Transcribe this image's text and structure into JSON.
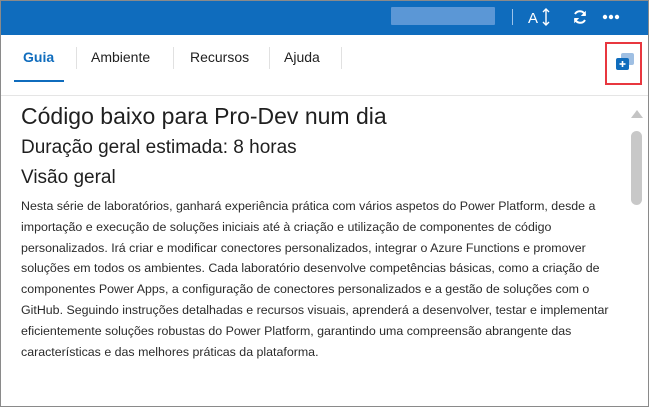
{
  "toolbar": {
    "text_size_icon": "text-size-icon",
    "refresh_icon": "refresh-icon",
    "more_icon": "more-options-icon",
    "accent": "#0f6cbd"
  },
  "tabs": [
    {
      "label": "Guia",
      "active": true
    },
    {
      "label": "Ambiente",
      "active": false
    },
    {
      "label": "Recursos",
      "active": false
    },
    {
      "label": "Ajuda",
      "active": false
    }
  ],
  "popout": {
    "icon": "open-in-new-window-icon",
    "highlight_color": "#e8373f"
  },
  "content": {
    "title": "Código baixo para Pro-Dev num dia",
    "duration": "Duração geral estimada: 8 horas",
    "overview_heading": "Visão geral",
    "overview_text": "Nesta série de laboratórios, ganhará experiência prática com vários aspetos do Power Platform, desde a importação e execução de soluções iniciais até à criação e utilização de componentes de código personalizados. Irá criar e modificar conectores personalizados, integrar o Azure Functions e promover soluções em todos os ambientes. Cada laboratório desenvolve competências básicas, como a criação de componentes Power Apps, a configuração de conectores personalizados e a gestão de soluções com o GitHub. Seguindo instruções detalhadas e recursos visuais, aprenderá a desenvolver, testar e implementar eficientemente soluções robustas do Power Platform, garantindo uma compreensão abrangente das características e das melhores práticas da plataforma."
  }
}
